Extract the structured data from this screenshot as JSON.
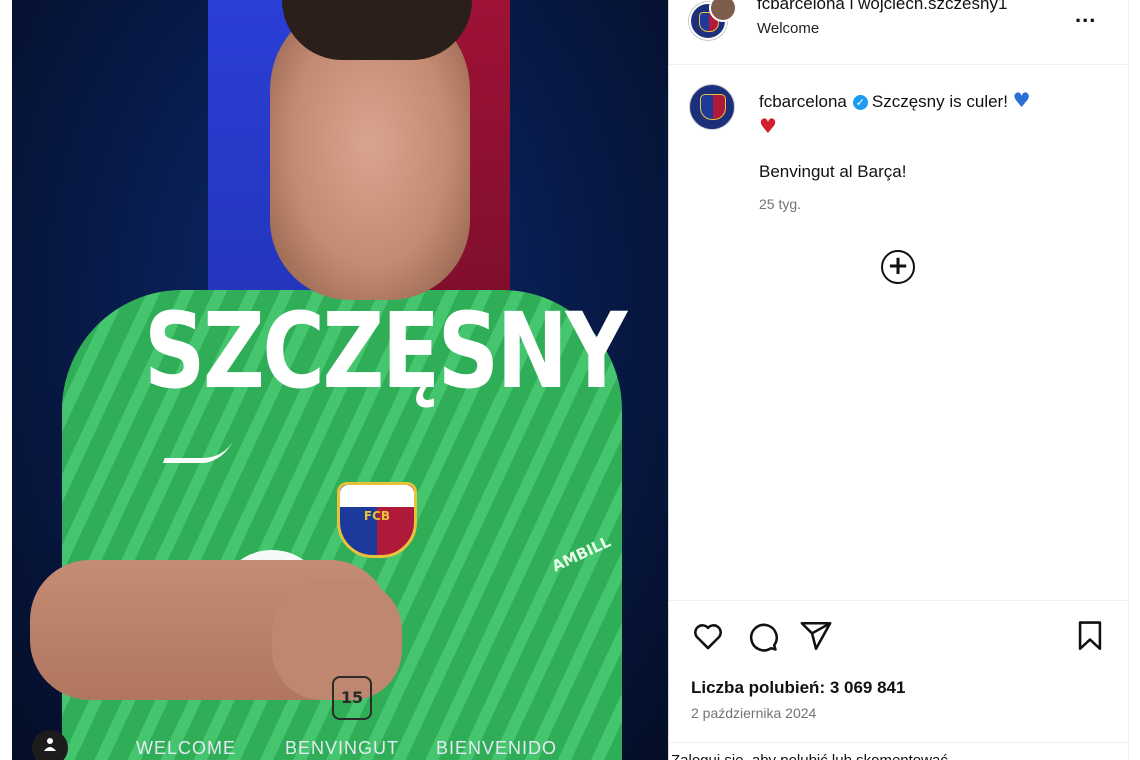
{
  "post_image": {
    "name_text": "SZCZĘSNY",
    "sleeve_text": "AMBILL",
    "badge_text": "15",
    "crest_text": "FCB",
    "bottom_words": [
      "WELCOME",
      "BENVINGUT",
      "BIENVENIDO"
    ],
    "tag_icon": "user-tag-icon"
  },
  "header": {
    "title": "fcbarcelona i wojciech.szczesny1",
    "subtitle": "Welcome",
    "more_label": "..."
  },
  "caption": {
    "username": "fcbarcelona",
    "verified_symbol": "✓",
    "text": "Szczęsny is culer!",
    "emoji_blue": "♥",
    "emoji_red": "♥",
    "second_line": "Benvingut al Barça!",
    "time": "25 tyg.",
    "add_symbol": "+"
  },
  "actions": {
    "like_icon": "heart-icon",
    "comment_icon": "comment-icon",
    "share_icon": "share-icon",
    "save_icon": "bookmark-icon"
  },
  "likes_text": "Liczba polubień: 3 069 841",
  "date_text": "2 października 2024",
  "bottom_cut_text": "Zaloguj się, aby polubić lub skomentować"
}
